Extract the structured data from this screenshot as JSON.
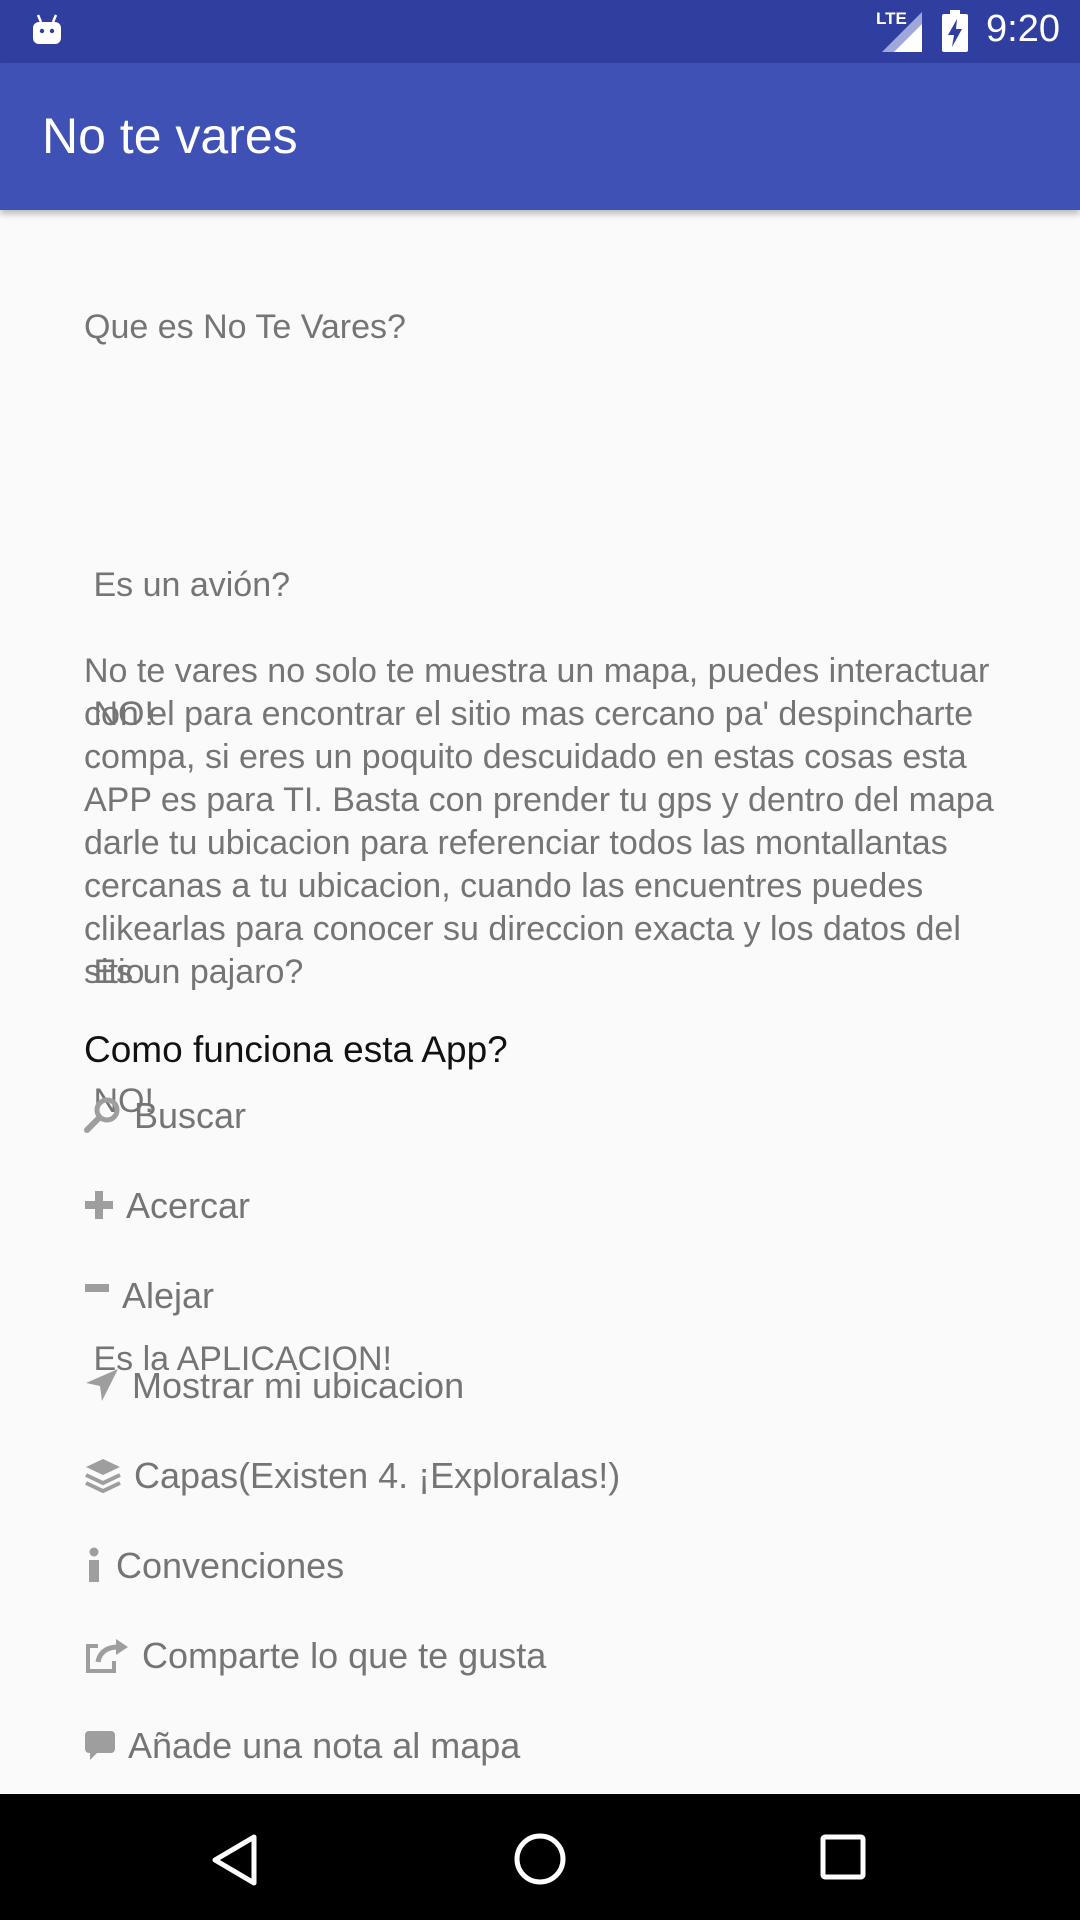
{
  "status_bar": {
    "network_label": "LTE",
    "time": "9:20",
    "icons": [
      "android-icon",
      "lte-signal-icon",
      "battery-charging-icon"
    ]
  },
  "app_bar": {
    "title": "No te vares"
  },
  "content": {
    "intro_lines": [
      "Que es No Te Vares?",
      "",
      " Es un avión?",
      " NO!",
      "",
      " Es un pajaro?",
      " NO!",
      "",
      " Es la APLICACION!"
    ],
    "description": "No te vares no solo te muestra un mapa, puedes interactuar con el para encontrar el sitio mas cercano pa' despincharte compa, si eres un poquito descuidado en estas cosas esta APP es para TI. Basta con prender tu gps y dentro del mapa darle tu ubicacion para referenciar todos las montallantas cercanas a tu ubicacion, cuando las encuentres puedes clikearlas para conocer su direccion exacta y los datos del sitio.",
    "section_title": "Como funciona esta App?",
    "help_items": [
      {
        "icon": "search-icon",
        "label": "Buscar"
      },
      {
        "icon": "plus-icon",
        "label": "Acercar"
      },
      {
        "icon": "minus-icon",
        "label": "Alejar"
      },
      {
        "icon": "location-arrow-icon",
        "label": "Mostrar mi ubicacion"
      },
      {
        "icon": "layers-icon",
        "label": "Capas(Existen 4. ¡Exploralas!)"
      },
      {
        "icon": "info-icon",
        "label": "Convenciones"
      },
      {
        "icon": "share-icon",
        "label": "Comparte lo que te gusta"
      },
      {
        "icon": "comment-icon",
        "label": "Añade una nota al mapa"
      }
    ]
  },
  "nav_bar": {
    "buttons": [
      "back-button",
      "home-button",
      "recents-button"
    ]
  },
  "colors": {
    "status_bar": "#303f9f",
    "app_bar": "#3f51b5",
    "background": "#fafafa",
    "body_text": "#757575",
    "section_title": "#111111"
  }
}
